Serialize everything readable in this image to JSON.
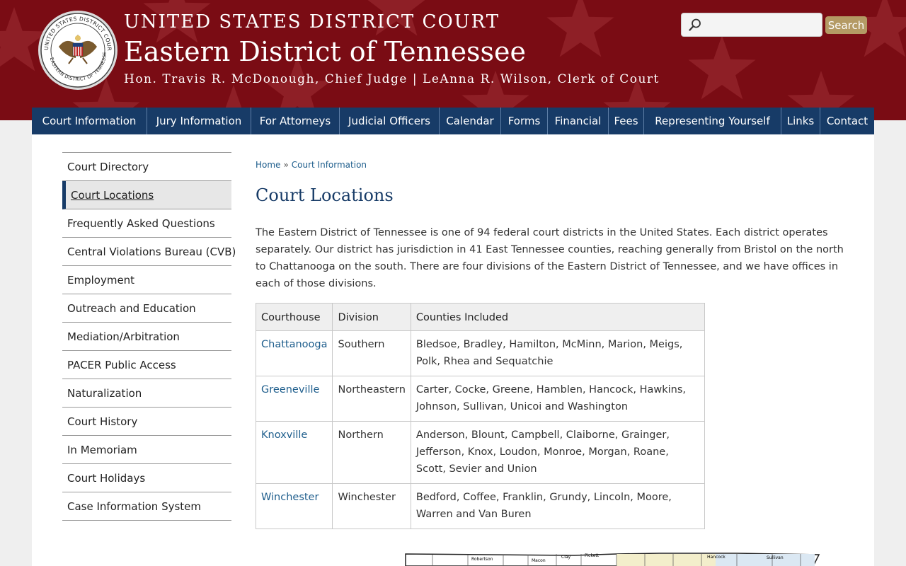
{
  "header": {
    "line1": "UNITED STATES DISTRICT COURT",
    "line2": "Eastern District of Tennessee",
    "line3": "Hon. Travis R. McDonough, Chief Judge | LeAnna R. Wilson, Clerk of Court",
    "seal_text": "UNITED STATES DISTRICT COURT · EASTERN DISTRICT OF TENNESSEE",
    "colors": {
      "banner": "#7a0c14",
      "nav": "#173b67",
      "search_button": "#b49a64"
    }
  },
  "search": {
    "placeholder": "",
    "button_label": "Search",
    "icon": "magnifier-icon"
  },
  "nav": [
    "Court Information",
    "Jury Information",
    "For Attorneys",
    "Judicial Officers",
    "Calendar",
    "Forms",
    "Financial",
    "Fees",
    "Representing Yourself",
    "Links",
    "Contact"
  ],
  "sidebar": {
    "items": [
      "Court Directory",
      "Court Locations",
      "Frequently Asked Questions",
      "Central Violations Bureau (CVB)",
      "Employment",
      "Outreach and Education",
      "Mediation/Arbitration",
      "PACER Public Access",
      "Naturalization",
      "Court History",
      "In Memoriam",
      "Court Holidays",
      "Case Information System"
    ],
    "active": "Court Locations"
  },
  "breadcrumb": {
    "home": "Home",
    "separator": "»",
    "current": "Court Information"
  },
  "page": {
    "title": "Court Locations",
    "intro": "The Eastern District of Tennessee is one of 94 federal court districts in the United States. Each district operates separately. Our district has jurisdiction in 41 East Tennessee counties, reaching generally from Bristol on the north to Chattanooga on the south.  There are four divisions of the Eastern District of Tennessee, and we have offices in each of those divisions."
  },
  "table": {
    "headers": [
      "Courthouse",
      "Division",
      "Counties Included"
    ],
    "rows": [
      [
        "Chattanooga",
        "Southern",
        "Bledsoe, Bradley, Hamilton, McMinn, Marion, Meigs, Polk, Rhea and Sequatchie"
      ],
      [
        "Greeneville",
        "Northeastern",
        "Carter, Cocke, Greene, Hamblen, Hancock, Hawkins, Johnson, Sullivan, Unicoi and Washington"
      ],
      [
        "Knoxville",
        "Northern",
        "Anderson, Blount, Campbell, Claiborne, Grainger, Jefferson, Knox, Loudon, Monroe, Morgan, Roane, Scott, Sevier and Union"
      ],
      [
        "Winchester",
        "Winchester",
        "Bedford, Coffee, Franklin, Grundy, Lincoln, Moore, Warren and Van Buren"
      ]
    ]
  },
  "map": {
    "labels": [
      "Robertson",
      "Macon",
      "Clay",
      "Pickett",
      "Hancock",
      "Sullivan"
    ]
  }
}
